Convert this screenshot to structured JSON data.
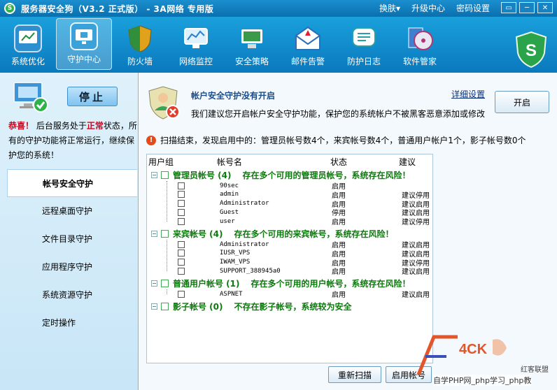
{
  "app": {
    "title": "服务器安全狗（V3.2 正式版） - 3A网络 专用版",
    "menu": [
      "换肤▾",
      "升级中心",
      "密码设置"
    ],
    "window_buttons": [
      "▭",
      "─",
      "✕"
    ]
  },
  "toolbar": {
    "items": [
      {
        "label": "系统优化",
        "icon": "system-optimize-icon",
        "color": "#2d8fd0"
      },
      {
        "label": "守护中心",
        "icon": "guard-center-icon",
        "color": "#3aa2d8",
        "active": true
      },
      {
        "label": "防火墙",
        "icon": "firewall-shield-icon",
        "color": "#e0a21a"
      },
      {
        "label": "网络监控",
        "icon": "network-monitor-icon",
        "color": "#4b9ee0"
      },
      {
        "label": "安全策略",
        "icon": "security-policy-icon",
        "color": "#3b9a49"
      },
      {
        "label": "邮件告警",
        "icon": "mail-alert-icon",
        "color": "#2c6db8"
      },
      {
        "label": "防护日志",
        "icon": "protect-log-icon",
        "color": "#27a0a8"
      },
      {
        "label": "软件管家",
        "icon": "software-manager-icon",
        "color": "#b2366d"
      }
    ]
  },
  "sidebar": {
    "stop_label": "停止",
    "status": {
      "congrats": "恭喜！",
      "text_a": " 后台服务处于",
      "normal": "正常",
      "text_b": "状态，所有的守护功能将正常运行，继续保护您的系统！"
    },
    "items": [
      {
        "label": "帐号安全守护",
        "active": true
      },
      {
        "label": "远程桌面守护"
      },
      {
        "label": "文件目录守护"
      },
      {
        "label": "应用程序守护"
      },
      {
        "label": "系统资源守护"
      },
      {
        "label": "定时操作"
      }
    ]
  },
  "main": {
    "alert_title": "帐户安全守护没有开启",
    "alert_desc": "我们建议您开启帐户安全守护功能，保护您的系统帐户不被黑客恶意添加或修改",
    "detail_link": "详细设置",
    "enable_label": "开启",
    "scan_summary": "扫描结束，发现启用中的：管理员帐号数4个，来宾帐号数4个，普通用户帐户1个，影子帐号数0个",
    "columns": [
      "用户组",
      "帐号名",
      "状态",
      "建议"
    ],
    "groups": [
      {
        "title": "管理员帐号 (4)",
        "message": "存在多个可用的管理员帐号，系统存在风险！",
        "rows": [
          {
            "name": "90sec",
            "status": "启用",
            "suggest": ""
          },
          {
            "name": "admin",
            "status": "启用",
            "suggest": "建议停用"
          },
          {
            "name": "Administrator",
            "status": "启用",
            "suggest": "建议启用"
          },
          {
            "name": "Guest",
            "status": "停用",
            "suggest": "建议启用"
          },
          {
            "name": "user",
            "status": "启用",
            "suggest": "建议停用"
          }
        ]
      },
      {
        "title": "来宾帐号 (4)",
        "message": "存在多个可用的来宾帐号，系统存在风险！",
        "rows": [
          {
            "name": "Administrator",
            "status": "启用",
            "suggest": "建议启用"
          },
          {
            "name": "IUSR_VPS",
            "status": "启用",
            "suggest": "建议启用"
          },
          {
            "name": "IWAM_VPS",
            "status": "启用",
            "suggest": "建议停用"
          },
          {
            "name": "SUPPORT_388945a0",
            "status": "启用",
            "suggest": "建议启用"
          }
        ]
      },
      {
        "title": "普通用户帐号 (1)",
        "message": "存在多个可用的用户帐号，系统存在风险！",
        "rows": [
          {
            "name": "ASPNET",
            "status": "启用",
            "suggest": "建议启用"
          }
        ]
      },
      {
        "title": "影子帐号 (0)",
        "message": "不存在影子帐号，系统较为安全",
        "rows": []
      }
    ],
    "rescan_label": "重新扫描",
    "enable_account_label": "启用帐号"
  },
  "watermark": {
    "text": "自学PHP网_php学习_php教",
    "logo_text": "4CK",
    "logo_sub": "红客联盟"
  },
  "colors": {
    "titlebar": "#0b6fae",
    "toolbar": "#1aa0dc",
    "group_green": "#0d7a0d",
    "warn_red": "#d0021b"
  }
}
